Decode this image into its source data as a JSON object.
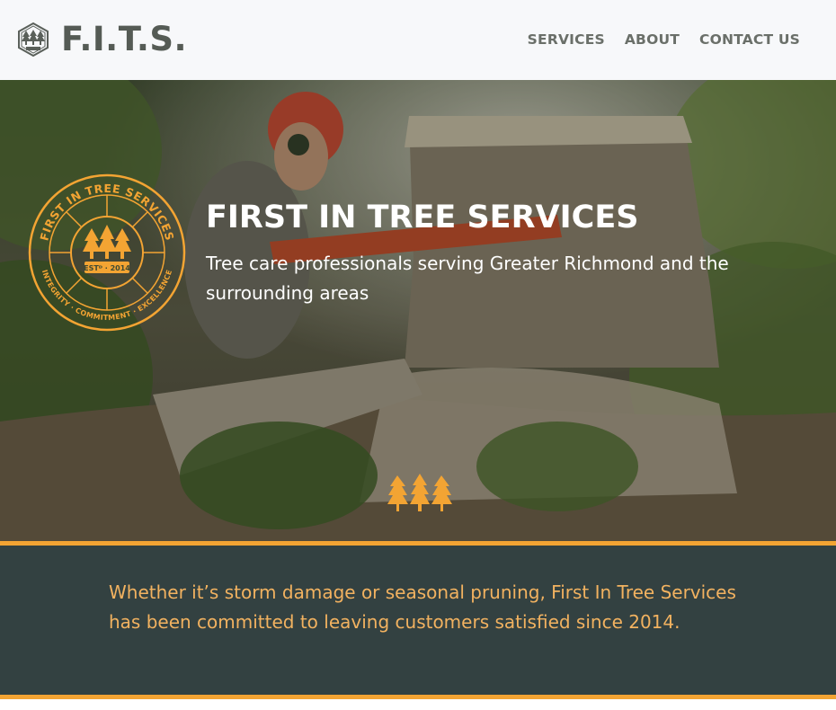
{
  "brand": {
    "logo_text": "F.I.T.S.",
    "logo_icon": "tree-hexagon-logo",
    "logo_small_caption": "F.I.T.S."
  },
  "nav": {
    "items": [
      {
        "label": "SERVICES"
      },
      {
        "label": "ABOUT"
      },
      {
        "label": "CONTACT US"
      }
    ]
  },
  "hero": {
    "title": "FIRST IN TREE SERVICES",
    "subtitle": "Tree care professionals serving Greater Richmond and the surrounding areas",
    "badge": {
      "top_text": "FIRST IN TREE SERVICES",
      "established": "ESTᴰ · 2014",
      "bottom_text": "INTEGRITY · COMMITMENT · EXCELLENCE"
    },
    "divider_icon": "three-trees-icon"
  },
  "intro": {
    "text": "Whether it’s storm damage or seasonal pruning, First In Tree Services has been committed to leaving customers satisfied since 2014."
  },
  "colors": {
    "accent_orange": "#f3a433",
    "dark_band": "#334141",
    "band_text": "#f2b260",
    "logo_gray": "#555b55",
    "nav_gray": "#6a6f69"
  }
}
